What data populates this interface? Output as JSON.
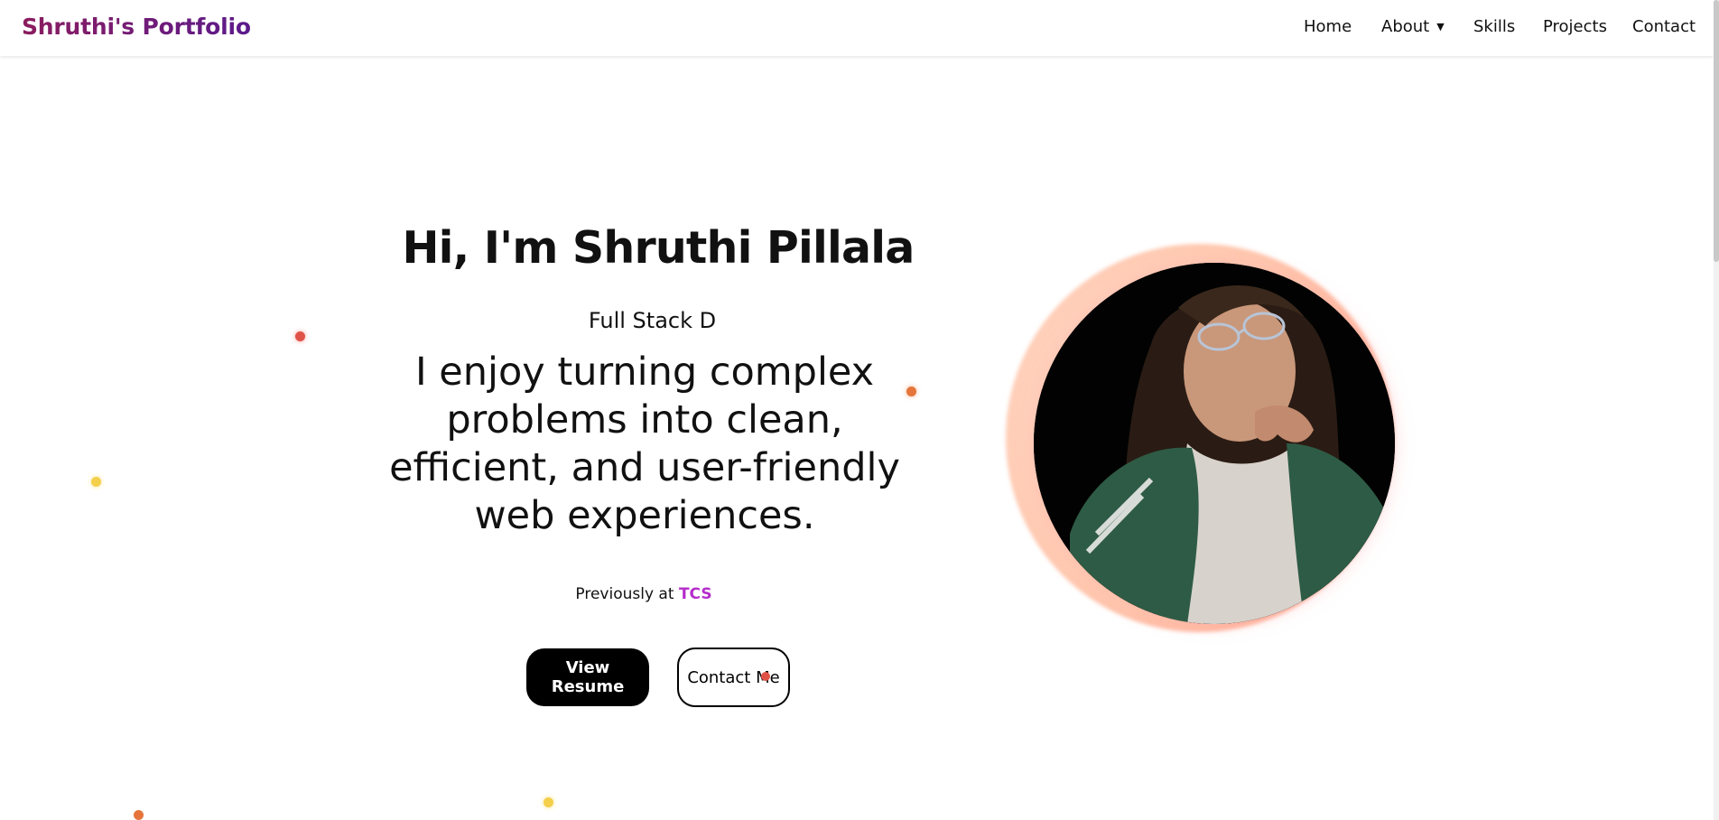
{
  "navbar": {
    "brand": "Shruthi's Portfolio",
    "items": [
      {
        "label": "Home"
      },
      {
        "label": "About"
      },
      {
        "label": "Skills"
      },
      {
        "label": "Projects"
      },
      {
        "label": "Contact"
      }
    ]
  },
  "hero": {
    "title": "Hi, I'm Shruthi Pillala",
    "subtitle": "Full Stack D",
    "tagline": "I enjoy turning complex problems into clean, efficient, and user-friendly web experiences.",
    "previously_prefix": "Previously at",
    "previously_company": "TCS",
    "resume_button": "View Resume",
    "contact_button": "Contact Me"
  },
  "colors": {
    "accent_purple": "#b52ccb",
    "brand_gradient_start": "#8b1d5f",
    "brand_gradient_end": "#5b1a8c",
    "dot_red": "#e05247",
    "dot_orange": "#e5753a",
    "dot_yellow": "#f4cf4a"
  },
  "icons": {
    "about_caret": "caret-down-icon"
  }
}
